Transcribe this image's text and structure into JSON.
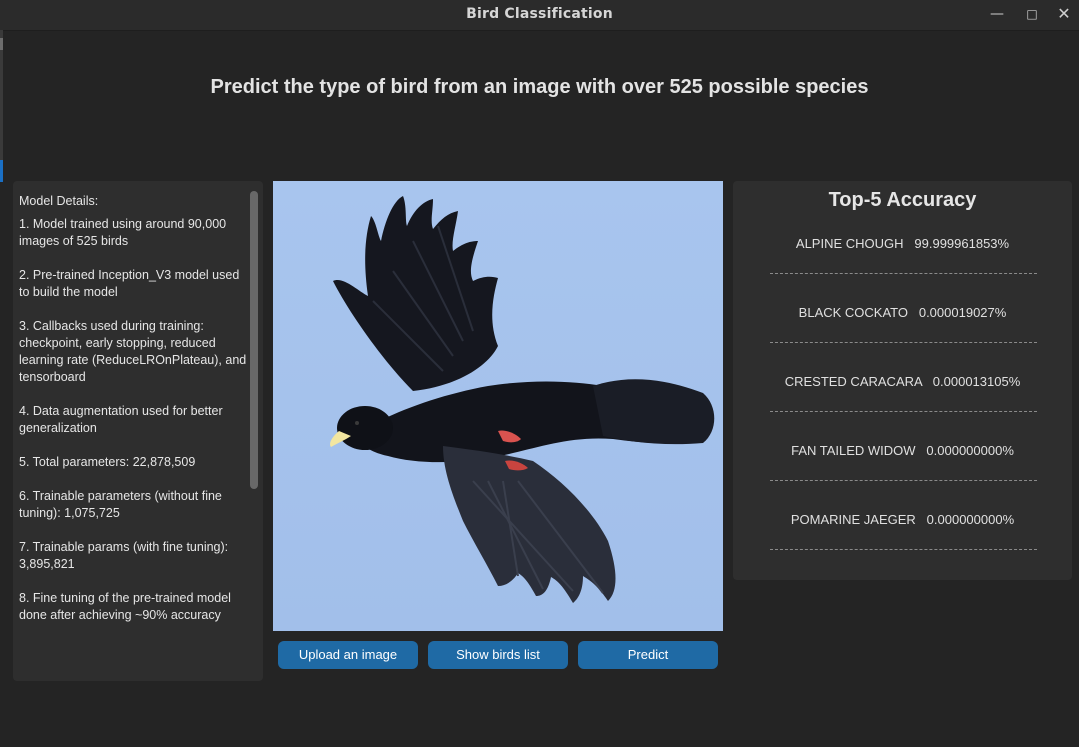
{
  "window": {
    "title": "Bird Classification"
  },
  "headline": "Predict the type of bird from an image with over 525 possible species",
  "details": {
    "heading": "Model Details:",
    "items": [
      "1. Model trained using around 90,000 images of 525 birds",
      "2. Pre-trained Inception_V3 model used to build the model",
      "3. Callbacks used during training: checkpoint, early stopping, reduced learning rate (ReduceLROnPlateau), and tensorboard",
      "4. Data augmentation used for better generalization",
      "5. Total parameters: 22,878,509",
      "6. Trainable parameters (without fine tuning): 1,075,725",
      "7. Trainable params (with fine tuning): 3,895,821",
      "8. Fine tuning of the pre-trained model done after achieving ~90% accuracy"
    ]
  },
  "buttons": {
    "upload": "Upload an image",
    "birds_list": "Show birds list",
    "predict": "Predict"
  },
  "results": {
    "title": "Top-5 Accuracy",
    "items": [
      {
        "name": "ALPINE CHOUGH",
        "score": "99.999961853%"
      },
      {
        "name": "BLACK COCKATO",
        "score": "0.000019027%"
      },
      {
        "name": "CRESTED CARACARA",
        "score": "0.000013105%"
      },
      {
        "name": "FAN TAILED WIDOW",
        "score": "0.000000000%"
      },
      {
        "name": "POMARINE JAEGER",
        "score": "0.000000000%"
      }
    ]
  },
  "colors": {
    "background": "#242424",
    "panel": "#2e2e2e",
    "button": "#1f6aa5",
    "sky": "#a6c3ec"
  }
}
